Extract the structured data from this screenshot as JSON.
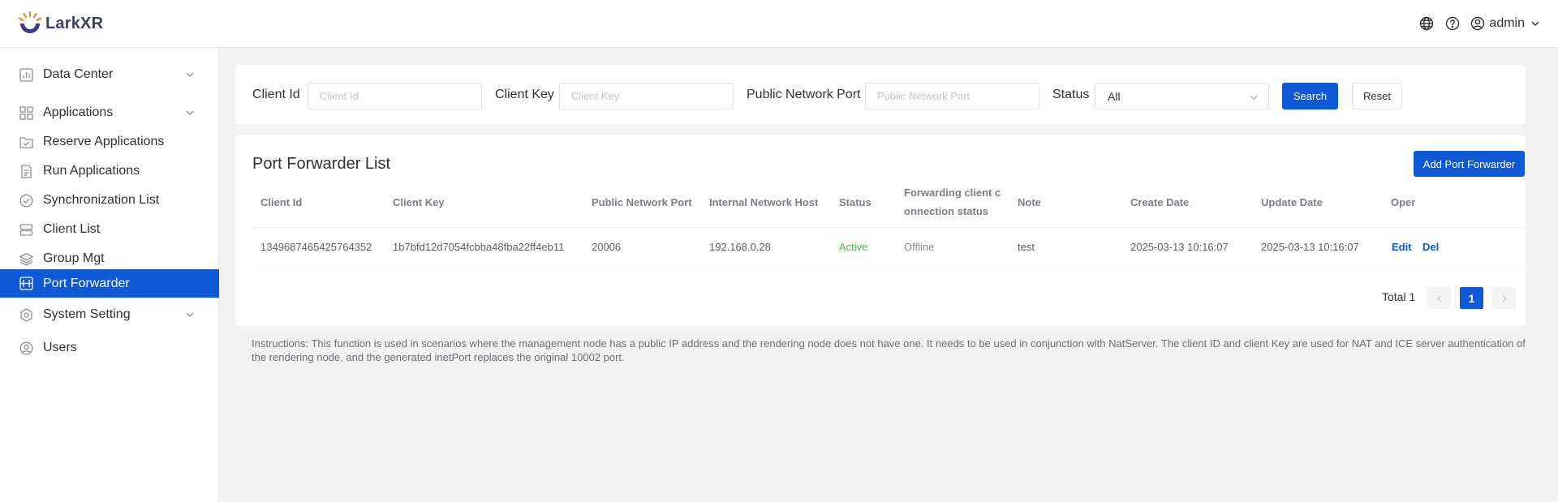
{
  "app": {
    "name": "LarkXR"
  },
  "header": {
    "user_name": "admin",
    "icons": [
      "globe-icon",
      "help-icon",
      "user-icon"
    ]
  },
  "sidebar": {
    "items": [
      {
        "label": "Data Center",
        "icon": "chart-icon",
        "expandable": true
      },
      {
        "label": "Applications",
        "icon": "grid-icon",
        "expandable": true
      },
      {
        "label": "Reserve Applications",
        "icon": "folder-check-icon"
      },
      {
        "label": "Run Applications",
        "icon": "document-icon"
      },
      {
        "label": "Synchronization List",
        "icon": "check-circle-icon"
      },
      {
        "label": "Client List",
        "icon": "server-icon"
      },
      {
        "label": "Group Mgt",
        "icon": "layers-icon"
      },
      {
        "label": "Port Forwarder",
        "icon": "port-icon",
        "active": true
      },
      {
        "label": "System Setting",
        "icon": "gear-icon",
        "expandable": true
      },
      {
        "label": "Users",
        "icon": "user-circle-icon"
      }
    ]
  },
  "filters": {
    "client_id": {
      "label": "Client Id",
      "placeholder": "Client Id",
      "value": ""
    },
    "client_key": {
      "label": "Client Key",
      "placeholder": "Client Key",
      "value": ""
    },
    "public_port": {
      "label": "Public Network Port",
      "placeholder": "Public Network Port",
      "value": ""
    },
    "status": {
      "label": "Status",
      "value": "All"
    },
    "search_label": "Search",
    "reset_label": "Reset"
  },
  "list": {
    "title": "Port Forwarder List",
    "add_label": "Add Port Forwarder",
    "columns": {
      "client_id": "Client Id",
      "client_key": "Client Key",
      "public_port": "Public Network Port",
      "internal_host": "Internal Network Host",
      "status": "Status",
      "fwd_status_line1": "Forwarding client c",
      "fwd_status_line2": "onnection status",
      "note": "Note",
      "create_date": "Create Date",
      "update_date": "Update Date",
      "oper": "Oper"
    },
    "rows": [
      {
        "client_id": "1349687465425764352",
        "client_key": "1b7bfd12d7054fcbba48fba22ff4eb11",
        "public_port": "20006",
        "internal_host": "192.168.0.28",
        "status": "Active",
        "fwd_status": "Offline",
        "note": "test",
        "create_date": "2025-03-13 10:16:07",
        "update_date": "2025-03-13 10:16:07",
        "edit_label": "Edit",
        "del_label": "Del"
      }
    ]
  },
  "pagination": {
    "total_text": "Total 1",
    "current_page": "1"
  },
  "instructions": "Instructions: This function is used in scenarios where the management node has a public IP address and the rendering node does not have one. It needs to be used in conjunction with NatServer. The client ID and client Key are used for NAT and ICE server authentication of the rendering node, and the generated inetPort replaces the original 10002 port.",
  "colors": {
    "primary": "#0f58d6",
    "active_status": "#52b84a",
    "background": "#f2f2f2"
  }
}
